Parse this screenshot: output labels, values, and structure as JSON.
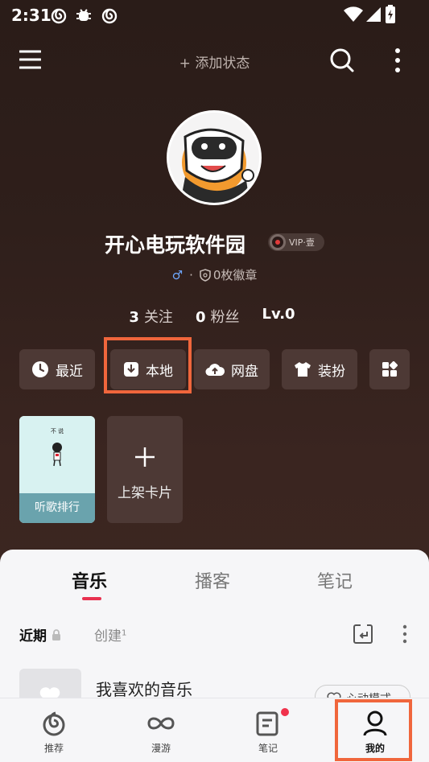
{
  "status_bar": {
    "time": "2:31"
  },
  "top_bar": {
    "add_status": "+ 添加状态"
  },
  "profile": {
    "name": "开心电玩软件园",
    "vip_badge": "VIP·壹",
    "gender_symbol": "♂",
    "separator": "·",
    "badges": "0枚徽章",
    "stats": [
      {
        "value": "3",
        "label": "关注"
      },
      {
        "value": "0",
        "label": "粉丝"
      },
      {
        "value": "Lv.0",
        "label": ""
      }
    ]
  },
  "quick_actions": [
    {
      "label": "最近",
      "icon": "clock-icon"
    },
    {
      "label": "本地",
      "icon": "download-box-icon"
    },
    {
      "label": "网盘",
      "icon": "cloud-upload-icon"
    },
    {
      "label": "装扮",
      "icon": "tshirt-icon"
    },
    {
      "label": "",
      "icon": "grid-icon"
    }
  ],
  "cards": [
    {
      "label": "听歌排行",
      "art_text": "不 说"
    },
    {
      "label": "上架卡片",
      "icon": "plus-icon"
    }
  ],
  "main_tabs": [
    {
      "label": "音乐",
      "active": true
    },
    {
      "label": "播客",
      "active": false
    },
    {
      "label": "笔记",
      "active": false
    }
  ],
  "sub_tabs": {
    "recent": "近期",
    "created": "创建",
    "created_count": "1"
  },
  "playlist": {
    "title": "我喜欢的音乐",
    "heart_mode": "心动模式"
  },
  "bottom_nav": [
    {
      "label": "推荐",
      "icon": "netease-logo-icon"
    },
    {
      "label": "漫游",
      "icon": "infinity-icon"
    },
    {
      "label": "笔记",
      "icon": "note-icon"
    },
    {
      "label": "我的",
      "icon": "person-icon",
      "active": true
    }
  ],
  "colors": {
    "accent_red": "#e8304f",
    "highlight_orange": "#f0663c",
    "bg_dark": "#2f1f1b"
  }
}
